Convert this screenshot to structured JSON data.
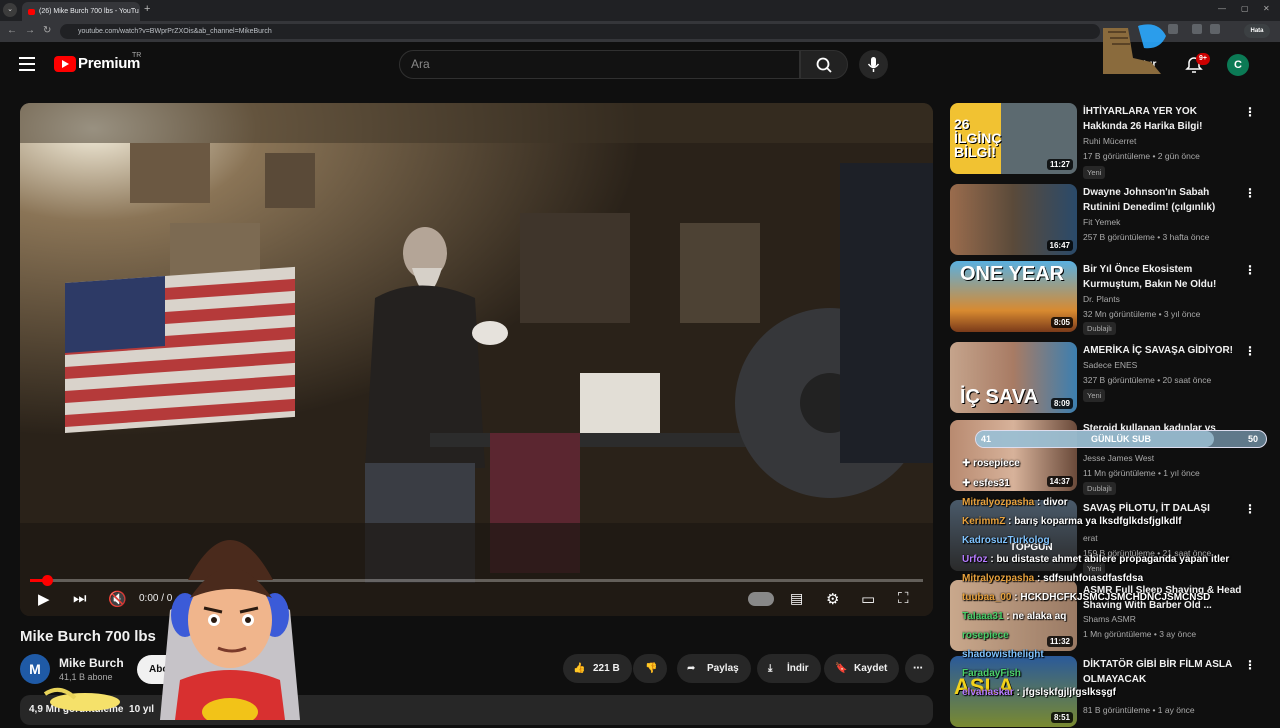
{
  "browser": {
    "tab_title": "(26) Mike Burch 700 lbs - YouTu",
    "url": "youtube.com/watch?v=BWprPrZXOis&ab_channel=MikeBurch",
    "profile_label": "Hata"
  },
  "header": {
    "brand": "Premium",
    "country": "TR",
    "search_placeholder": "Ara",
    "create_label": "tur",
    "notif_count": "9+",
    "user_initial": "C"
  },
  "player": {
    "time": "0:00 / 0"
  },
  "video": {
    "title": "Mike Burch 700 lbs",
    "channel": "Mike Burch",
    "channel_initial": "M",
    "subscribers": "41,1 B abone",
    "subscribe_label": "Abo",
    "likes": "221 B",
    "share_label": "Paylaş",
    "download_label": "İndir",
    "save_label": "Kaydet",
    "views": "4,9 Mn görüntüleme",
    "age": "10 yıl"
  },
  "recommendations": [
    {
      "title": "İHTİYARLARA YER YOK Hakkında 26 Harika Bilgi!",
      "channel": "Ruhi Mücerret",
      "meta": "17 B görüntüleme • 2 gün önce",
      "badge": "Yeni",
      "duration": "11:27",
      "thumb_text": "26 İLGİNÇ BİLGİ!",
      "verified": false
    },
    {
      "title": "Dwayne Johnson'ın Sabah Rutinini Denedim! (çılgınlık)",
      "channel": "Fit Yemek",
      "meta": "257 B görüntüleme • 3 hafta önce",
      "badge": "",
      "duration": "16:47",
      "thumb_text": "",
      "verified": true
    },
    {
      "title": "Bir Yıl Önce Ekosistem Kurmuştum, Bakın Ne Oldu!",
      "channel": "Dr. Plants",
      "meta": "32 Mn görüntüleme • 3 yıl önce",
      "badge": "Dublajlı",
      "duration": "8:05",
      "thumb_text": "ONE YEAR",
      "verified": true
    },
    {
      "title": "AMERİKA İÇ SAVAŞA GİDİYOR!",
      "channel": "Sadece ENES",
      "meta": "327 B görüntüleme • 20 saat önce",
      "badge": "Yeni",
      "duration": "8:09",
      "thumb_text": "İÇ SAVA",
      "verified": true
    },
    {
      "title": "Steroid kullanan kadınlar vs",
      "channel": "Jesse James West",
      "meta": "11 Mn görüntüleme • 1 yıl önce",
      "badge": "Dublajlı",
      "duration": "14:37",
      "thumb_text": "",
      "verified": true
    },
    {
      "title": "SAVAŞ PİLOTU, İT DALAŞI",
      "channel": "erat",
      "meta": "159 B görüntüleme • 21 saat önce",
      "badge": "Yeni",
      "duration": "",
      "thumb_text": "TOPGUN",
      "verified": true
    },
    {
      "title": "ASMR Full Sleep Shaving & Head Shaving With Barber Old ...",
      "channel": "Shams ASMR",
      "meta": "1 Mn görüntüleme • 3 ay önce",
      "badge": "",
      "duration": "11:32",
      "thumb_text": "",
      "verified": false
    },
    {
      "title": "DİKTATÖR GİBİ BİR FİLM ASLA OLMAYACAK",
      "channel": "",
      "meta": "81 B görüntüleme • 1 ay önce",
      "badge": "",
      "duration": "8:51",
      "thumb_text": "ASLA",
      "verified": false
    }
  ],
  "overlay": {
    "sub_left": "41",
    "sub_label": "GÜNLÜK SUB",
    "sub_right": "50",
    "sub_progress": 0.82,
    "sub_event_1": "rosepiece",
    "sub_event_2": "esfes31",
    "chat": [
      {
        "user": "Mitralyozpasha",
        "msg": "divor",
        "cls": "u"
      },
      {
        "user": "KerimmZ",
        "msg": "barış koparma ya lksdfglkdsfjglkdlf",
        "cls": "u"
      },
      {
        "user": "KadrosuzTurkolog",
        "msg": "",
        "cls": "u3"
      },
      {
        "user": "Urfoz",
        "msg": "bu distaste ahmet abilere propaganda yapan itler",
        "cls": "u4"
      },
      {
        "user": "Mitralyozpasha",
        "msg": "sdfsıuhfoıasdfasfdsa",
        "cls": "u"
      },
      {
        "user": "tuubaa_00",
        "msg": "HCKDHCFKJSMCJSMCHDNCJSMCNSD",
        "cls": "u"
      },
      {
        "user": "Talaaa31",
        "msg": "ne alaka aq",
        "cls": "u2"
      },
      {
        "user": "rosepiece",
        "msg": "",
        "cls": "u2"
      },
      {
        "user": "shadowisthelight",
        "msg": "",
        "cls": "u3"
      },
      {
        "user": "FaradayFish",
        "msg": "",
        "cls": "u2"
      },
      {
        "user": "elvanaskar",
        "msg": "jfgslşkfgjljfgslksşgf",
        "cls": "u4"
      }
    ]
  },
  "colors": {
    "accent": "#ff0000",
    "background": "#0f0f0f",
    "surface": "#272727"
  }
}
